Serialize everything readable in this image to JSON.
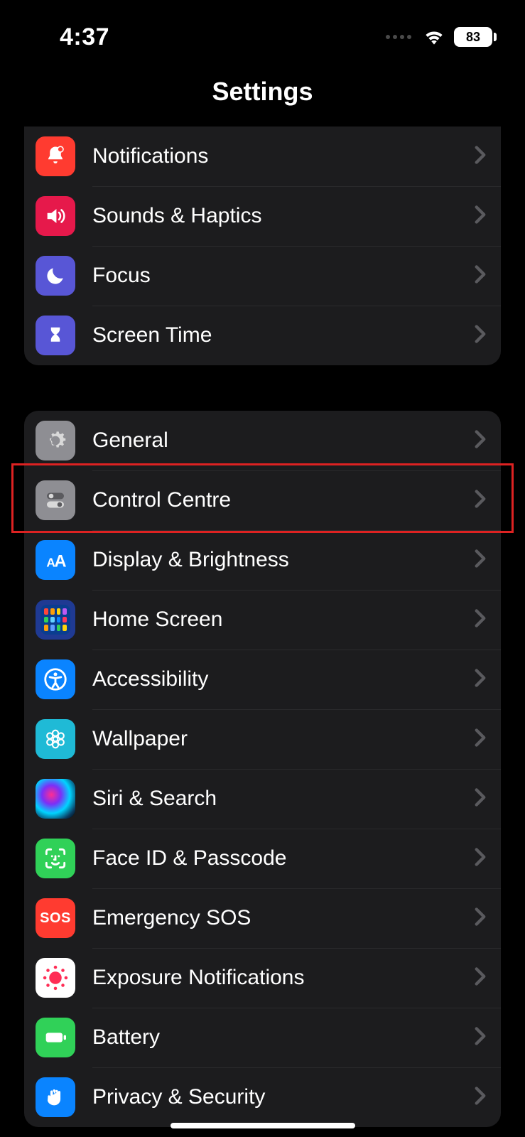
{
  "status": {
    "time": "4:37",
    "battery": "83"
  },
  "title": "Settings",
  "groups": [
    {
      "id": "g1",
      "items": [
        {
          "id": "notifications",
          "label": "Notifications"
        },
        {
          "id": "sounds-haptics",
          "label": "Sounds & Haptics"
        },
        {
          "id": "focus",
          "label": "Focus"
        },
        {
          "id": "screen-time",
          "label": "Screen Time"
        }
      ]
    },
    {
      "id": "g2",
      "items": [
        {
          "id": "general",
          "label": "General"
        },
        {
          "id": "control-centre",
          "label": "Control Centre"
        },
        {
          "id": "display-brightness",
          "label": "Display & Brightness"
        },
        {
          "id": "home-screen",
          "label": "Home Screen"
        },
        {
          "id": "accessibility",
          "label": "Accessibility"
        },
        {
          "id": "wallpaper",
          "label": "Wallpaper"
        },
        {
          "id": "siri-search",
          "label": "Siri & Search"
        },
        {
          "id": "face-id",
          "label": "Face ID & Passcode"
        },
        {
          "id": "emergency-sos",
          "label": "Emergency SOS"
        },
        {
          "id": "exposure-notifications",
          "label": "Exposure Notifications"
        },
        {
          "id": "battery",
          "label": "Battery"
        },
        {
          "id": "privacy-security",
          "label": "Privacy & Security"
        }
      ]
    }
  ],
  "highlighted_item": "control-centre",
  "icon_colors": {
    "notifications": "#ff3b30",
    "sounds-haptics": "#e6194b",
    "focus": "#5856d6",
    "screen-time": "#5856d6",
    "general": "#8e8e93",
    "control-centre": "#8e8e93",
    "display-brightness": "#0a84ff",
    "home-screen": "#1f3a93",
    "accessibility": "#0a84ff",
    "wallpaper": "#1fbad6",
    "siri-search": "#000",
    "face-id": "#30d158",
    "emergency-sos": "#ff3b30",
    "exposure-notifications": "#ffffff",
    "battery": "#30d158",
    "privacy-security": "#0a84ff"
  },
  "sos_text": "SOS"
}
